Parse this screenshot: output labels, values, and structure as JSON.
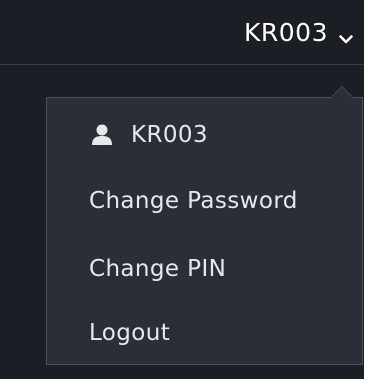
{
  "header": {
    "username": "KR003",
    "toggle_icon": "chevron-down-icon"
  },
  "dropdown": {
    "user_label": "KR003",
    "user_icon": "user-icon",
    "items": [
      {
        "label": "Change Password"
      },
      {
        "label": "Change PIN"
      },
      {
        "label": "Logout"
      }
    ]
  },
  "colors": {
    "background": "#1b1e24",
    "dropdown_bg": "#2a2f37",
    "text": "#e6e8eb",
    "accent_text": "#ffffff"
  }
}
